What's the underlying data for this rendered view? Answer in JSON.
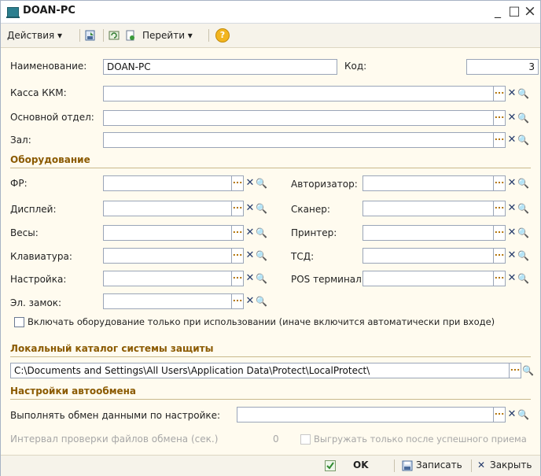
{
  "window": {
    "title": "DOAN-PC",
    "minimize": "_",
    "maximize": "□",
    "close": "×"
  },
  "toolbar": {
    "actions": "Действия ▾",
    "goto": "Перейти ▾",
    "help": "?"
  },
  "fields": {
    "name_label": "Наименование:",
    "name_value": "DOAN-PC",
    "code_label": "Код:",
    "code_value": "3",
    "kassa_label": "Касса ККМ:",
    "dept_label": "Основной отдел:",
    "hall_label": "Зал:"
  },
  "equipment": {
    "title": "Оборудование",
    "fr": "ФР:",
    "display": "Дисплей:",
    "scales": "Весы:",
    "keyboard": "Клавиатура:",
    "settings": "Настройка:",
    "lock": "Эл. замок:",
    "authorizer": "Авторизатор:",
    "scanner": "Сканер:",
    "printer": "Принтер:",
    "tsd": "ТСД:",
    "pos": "POS терминал:",
    "checkbox_label": "Включать оборудование только при использовании (иначе включится автоматически при входе)"
  },
  "protection": {
    "title": "Локальный каталог системы защиты",
    "path": "C:\\Documents and Settings\\All Users\\Application Data\\Protect\\LocalProtect\\"
  },
  "autoexchange": {
    "title": "Настройки автообмена",
    "exchange_label": "Выполнять обмен данными по настройке:",
    "interval_label": "Интервал проверки файлов обмена (сек.)",
    "interval_value": "0",
    "upload_label": "Выгружать только после успешного приема"
  },
  "footer": {
    "ok": "OK",
    "save": "Записать",
    "close": "Закрыть"
  }
}
